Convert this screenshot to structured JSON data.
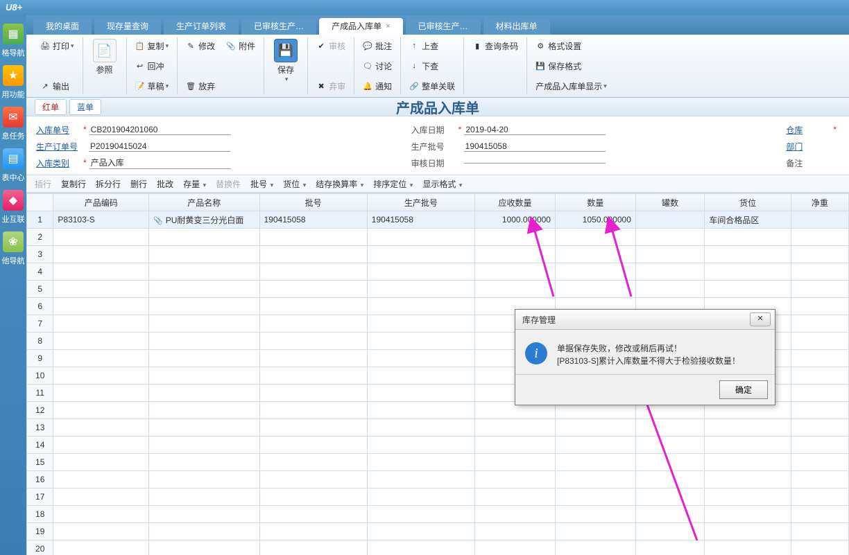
{
  "app_title": "U8+",
  "sidebar": [
    {
      "label": "格导航"
    },
    {
      "label": "用功能"
    },
    {
      "label": "息任务"
    },
    {
      "label": "表中心"
    },
    {
      "label": "业互联"
    },
    {
      "label": "他导航"
    }
  ],
  "tabs": [
    {
      "label": "我的桌面",
      "active": false
    },
    {
      "label": "现存量查询",
      "active": false
    },
    {
      "label": "生产订单列表",
      "active": false
    },
    {
      "label": "已审核生产…",
      "active": false
    },
    {
      "label": "产成品入库单",
      "active": true,
      "closable": true
    },
    {
      "label": "已审核生产…",
      "active": false
    },
    {
      "label": "材料出库单",
      "active": false
    }
  ],
  "ribbon": {
    "print": "打印",
    "output": "输出",
    "ref": "参照",
    "copy": "复制",
    "reverse": "回冲",
    "draft": "草稿",
    "modify": "修改",
    "attach": "附件",
    "discard": "放弃",
    "save": "保存",
    "audit": "审核",
    "abandon": "弃审",
    "approve": "批注",
    "discuss": "讨论",
    "notify": "通知",
    "prev": "上查",
    "next": "下查",
    "link": "整单关联",
    "barcode": "查询条码",
    "fmt": "格式设置",
    "savefmt": "保存格式",
    "display": "产成品入库单显示"
  },
  "pills": {
    "red": "红单",
    "blue": "蓝单"
  },
  "doc_title": "产成品入库单",
  "form": {
    "l1": {
      "lbl": "入库单号",
      "val": "CB201904201060",
      "star": true
    },
    "l2": {
      "lbl": "生产订单号",
      "val": "P20190415024"
    },
    "l3": {
      "lbl": "入库类别",
      "val": "产品入库",
      "star": true
    },
    "m1": {
      "lbl": "入库日期",
      "val": "2019-04-20",
      "star": true
    },
    "m2": {
      "lbl": "生产批号",
      "val": "190415058"
    },
    "m3": {
      "lbl": "审核日期",
      "val": ""
    },
    "r1": {
      "lbl": "仓库",
      "star": true
    },
    "r2": {
      "lbl": "部门"
    },
    "r3": {
      "lbl": "备注"
    }
  },
  "gridbar": [
    "插行",
    "复制行",
    "拆分行",
    "删行",
    "批改",
    "存量",
    "替换件",
    "批号",
    "货位",
    "结存换算率",
    "排序定位",
    "显示格式"
  ],
  "columns": [
    "产品编码",
    "产品名称",
    "批号",
    "生产批号",
    "应收数量",
    "数量",
    "罐数",
    "货位",
    "净重"
  ],
  "rows": [
    {
      "code": "P83103-S",
      "name": "PU耐黄变三分光白面",
      "batch": "190415058",
      "prodbatch": "190415058",
      "qty_req": "1000.000000",
      "qty": "1050.000000",
      "cans": "",
      "loc": "车间合格品区",
      "weight": ""
    }
  ],
  "row_count": 20,
  "dialog": {
    "title": "库存管理",
    "msg1": "单据保存失败，修改或稍后再试！",
    "msg2": "[P83103-S]累计入库数量不得大于检验接收数量！",
    "ok": "确定"
  }
}
